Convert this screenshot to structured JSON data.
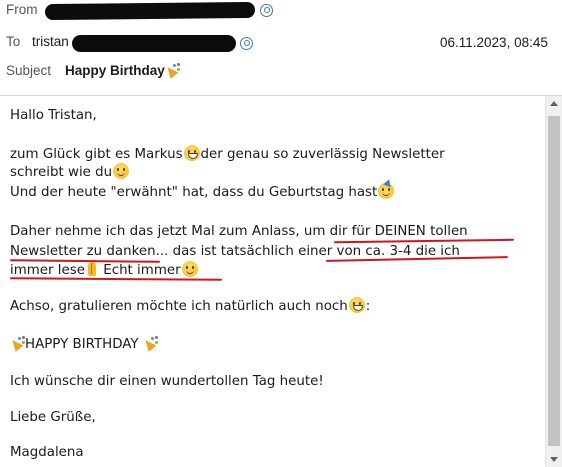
{
  "header": {
    "from_label": "From",
    "to_label": "To",
    "to_value": "tristan",
    "date": "06.11.2023, 08:45",
    "subject_label": "Subject",
    "subject": "Happy Birthday",
    "subject_icon": "party-popper-emoji"
  },
  "body": {
    "greeting": "Hallo Tristan,",
    "p1_l1_a": "zum Glück gibt es Markus",
    "p1_l1_b": "der genau so zuverlässig Newsletter",
    "p1_l2": "schreibt wie du",
    "p1_l3": "Und der heute \"erwähnt\" hat, dass du Geburtstag hast",
    "p2_l1_a": "Daher nehme ich das jetzt Mal zum Anlass, ",
    "p2_l1_b": "um dir für DEINEN tollen",
    "p2_l2_a": "Newsletter zu danken",
    "p2_l2_b": "... das ist tatsächlich ",
    "p2_l2_c": "einer von ca. 3-4 die ich",
    "p2_l3_a": "immer lese",
    "p2_l3_b": " Echt immer",
    "p3": "Achso, gratulieren möchte ich natürlich auch noch",
    "p3_end": ":",
    "happy": "HAPPY BIRTHDAY",
    "wish": "Ich wünsche dir einen wundertollen Tag heute!",
    "closing": "Liebe Grüße,",
    "signature": "Magdalena"
  },
  "annotations": {
    "underline_color": "#d4141c"
  },
  "colors": {
    "redaction": "#0c0c0c",
    "contact_icon": "#3a78c8"
  }
}
